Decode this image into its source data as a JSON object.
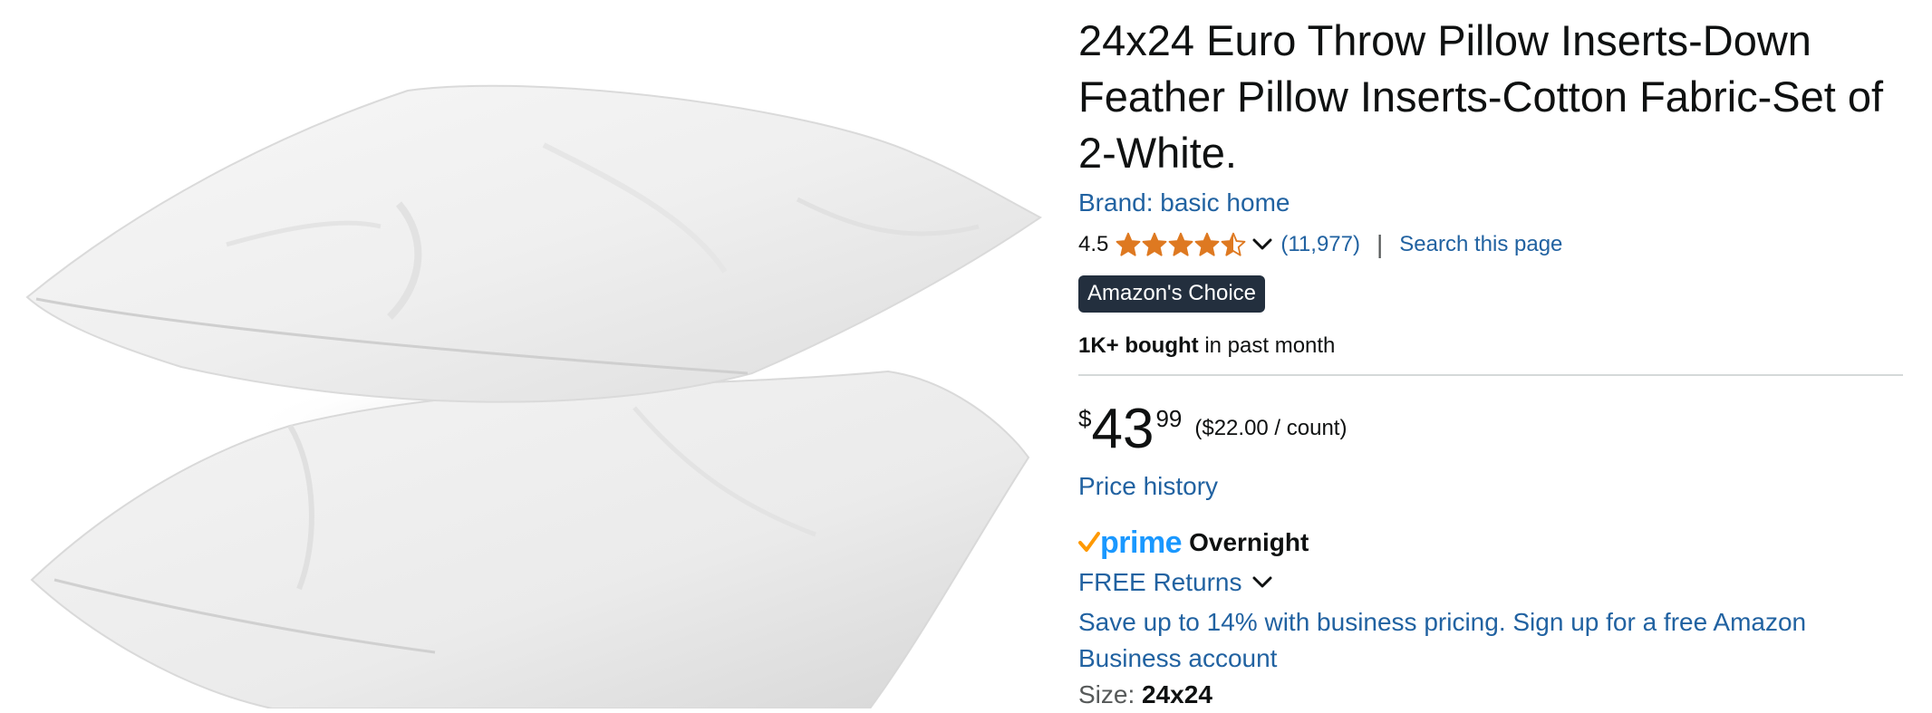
{
  "product": {
    "title": "24x24 Euro Throw Pillow Inserts-Down Feather Pillow Inserts-Cotton Fabric-Set of 2-White.",
    "brand": "Brand: basic home",
    "image_alt": "Two white square pillow inserts stacked",
    "rating": "4.5",
    "rating_value": 4.5,
    "rating_max": 5,
    "review_count": "(11,977)",
    "separator": "|",
    "search_link": "Search this page",
    "badge": "Amazon's Choice",
    "bought_bold": "1K+ bought",
    "bought_rest": " in past month",
    "price": {
      "currency": "$",
      "whole": "43",
      "fraction": "99",
      "unit": "($22.00 / count)"
    },
    "price_history": "Price history",
    "prime_word": "prime",
    "delivery": "Overnight",
    "returns": "FREE Returns",
    "business": "Save up to 14% with business pricing. Sign up for a free Amazon Business account",
    "size_label": "Size: ",
    "size_value": "24x24"
  },
  "colors": {
    "link": "#2162a1",
    "star": "#de7921",
    "prime_blue": "#1a98ff",
    "prime_check": "#ff9900",
    "badge_bg": "#232f3e",
    "text": "#0f1111"
  }
}
